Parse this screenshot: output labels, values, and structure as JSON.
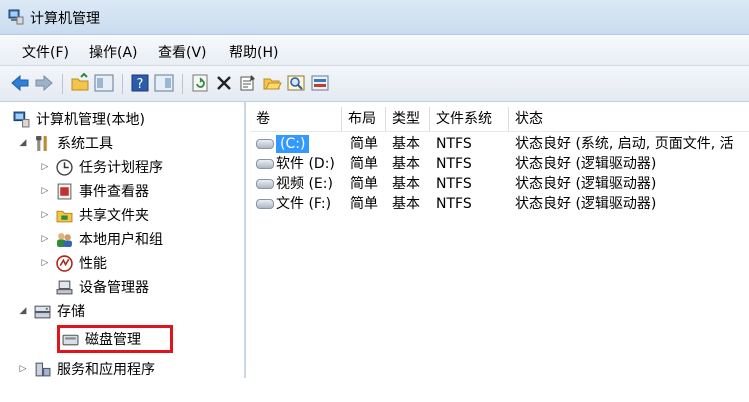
{
  "window": {
    "title": "计算机管理"
  },
  "menu": [
    "文件(F)",
    "操作(A)",
    "查看(V)",
    "帮助(H)"
  ],
  "toolbar": [
    "back-icon",
    "forward-icon",
    "up-folder-icon",
    "show-hide-tree-icon",
    "help-icon",
    "console-icon",
    "refresh-icon",
    "delete-icon",
    "properties-icon",
    "open-icon",
    "search-icon",
    "rescan-icon"
  ],
  "tree": {
    "root": "计算机管理(本地)",
    "system_tools": "系统工具",
    "task_scheduler": "任务计划程序",
    "event_viewer": "事件查看器",
    "shared_folders": "共享文件夹",
    "local_users": "本地用户和组",
    "performance": "性能",
    "device_manager": "设备管理器",
    "storage": "存储",
    "disk_management": "磁盘管理",
    "services": "服务和应用程序"
  },
  "list": {
    "columns": [
      "卷",
      "布局",
      "类型",
      "文件系统",
      "状态"
    ],
    "rows": [
      {
        "volume": "(C:)",
        "layout": "简单",
        "type": "基本",
        "fs": "NTFS",
        "status": "状态良好 (系统, 启动, 页面文件, 活",
        "selected": true
      },
      {
        "volume": "软件 (D:)",
        "layout": "简单",
        "type": "基本",
        "fs": "NTFS",
        "status": "状态良好 (逻辑驱动器)",
        "selected": false
      },
      {
        "volume": "视频 (E:)",
        "layout": "简单",
        "type": "基本",
        "fs": "NTFS",
        "status": "状态良好 (逻辑驱动器)",
        "selected": false
      },
      {
        "volume": "文件 (F:)",
        "layout": "简单",
        "type": "基本",
        "fs": "NTFS",
        "status": "状态良好 (逻辑驱动器)",
        "selected": false
      }
    ]
  },
  "colors": {
    "selection": "#3399ff",
    "highlight": "#e0141c"
  }
}
